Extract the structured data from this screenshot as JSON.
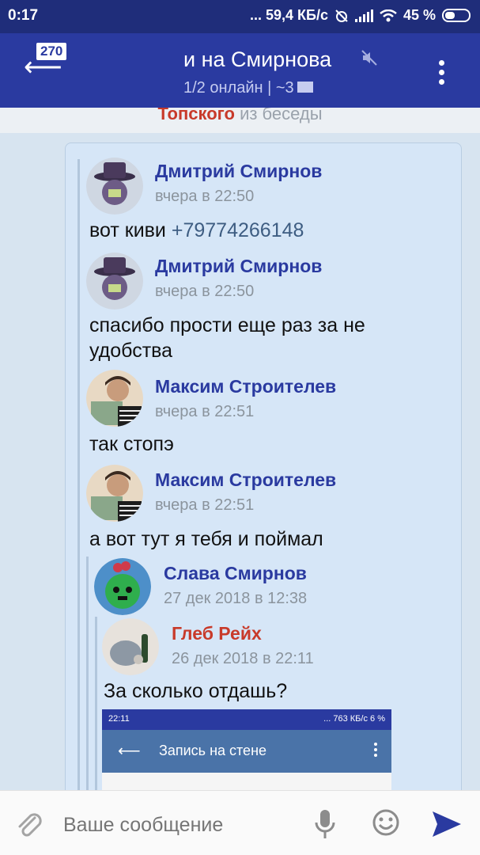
{
  "status_bar": {
    "time": "0:17",
    "network_speed": "... 59,4 КБ/с",
    "battery": "45 %"
  },
  "header": {
    "unread_count": "270",
    "title": "и на Смирнова",
    "subtitle": "1/2 онлайн | ~3"
  },
  "system_message": {
    "name": "Топского",
    "text": " из беседы"
  },
  "messages": [
    {
      "author": "Дмитрий Смирнов",
      "date": "вчера в 22:50",
      "text": "вот киви ",
      "phone": "+79774266148"
    },
    {
      "author": "Дмитрий Смирнов",
      "date": "вчера в 22:50",
      "text_lines": [
        "спасибо прости еще раз за не",
        "удобства"
      ]
    },
    {
      "author": "Максим Строителев",
      "date": "вчера в 22:51",
      "text": "так стопэ"
    },
    {
      "author": "Максим Строителев",
      "date": "вчера в 22:51",
      "text": "а вот тут я тебя и поймал"
    },
    {
      "author": "Слава Смирнов",
      "date": "27 дек 2018 в 12:38"
    },
    {
      "author": "Глеб Рейх",
      "date": "26 дек 2018 в 22:11",
      "text": "За сколько отдашь?"
    }
  ],
  "embedded_screenshot": {
    "time": "22:11",
    "status": "... 763 КБ/с",
    "battery": "6 %",
    "title": "Запись на стене"
  },
  "composer": {
    "placeholder": "Ваше сообщение"
  },
  "colors": {
    "header": "#2a3aa0",
    "status_bar": "#1f2d7a",
    "bubble": "#d6e6f7",
    "author_name": "#2a3aa0",
    "author_name_alt": "#c83a2a"
  }
}
